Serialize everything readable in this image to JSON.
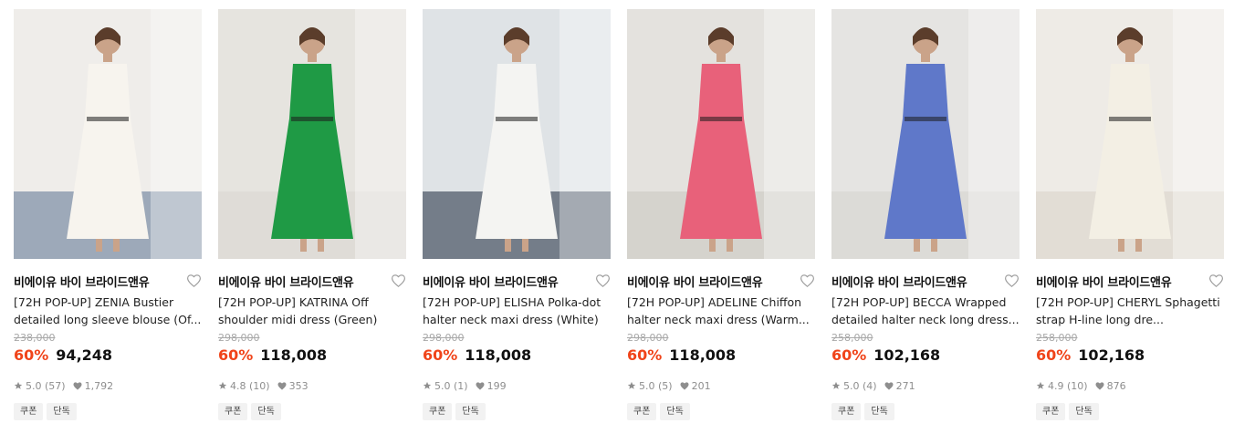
{
  "products": [
    {
      "brand": "비에이유 바이 브라이드앤유",
      "title": "[72H POP-UP] ZENIA Bustier detailed long sleeve blouse (Of...",
      "original_price": "238,000",
      "discount": "60%",
      "price": "94,248",
      "rating": "5.0 (57)",
      "likes": "1,792",
      "tags": [
        "쿠폰",
        "단독"
      ],
      "image_colors": {
        "bg": "#efedea",
        "garment": "#f7f4ee",
        "accent": "#5a7190"
      }
    },
    {
      "brand": "비에이유 바이 브라이드앤유",
      "title": "[72H POP-UP] KATRINA Off shoulder midi dress (Green)",
      "original_price": "298,000",
      "discount": "60%",
      "price": "118,008",
      "rating": "4.8 (10)",
      "likes": "353",
      "tags": [
        "쿠폰",
        "단독"
      ],
      "image_colors": {
        "bg": "#e6e4df",
        "garment": "#1f9a45",
        "accent": "#d9d6cf"
      }
    },
    {
      "brand": "비에이유 바이 브라이드앤유",
      "title": "[72H POP-UP] ELISHA Polka-dot halter neck maxi dress (White)",
      "original_price": "298,000",
      "discount": "60%",
      "price": "118,008",
      "rating": "5.0 (1)",
      "likes": "199",
      "tags": [
        "쿠폰",
        "단독"
      ],
      "image_colors": {
        "bg": "#dfe3e6",
        "garment": "#f4f4f2",
        "accent": "#1c2a3c"
      }
    },
    {
      "brand": "비에이유 바이 브라이드앤유",
      "title": "[72H POP-UP] ADELINE Chiffon halter neck maxi dress (Warm...",
      "original_price": "298,000",
      "discount": "60%",
      "price": "118,008",
      "rating": "5.0 (5)",
      "likes": "201",
      "tags": [
        "쿠폰",
        "단독"
      ],
      "image_colors": {
        "bg": "#e4e2de",
        "garment": "#e8617a",
        "accent": "#c9c6c0"
      }
    },
    {
      "brand": "비에이유 바이 브라이드앤유",
      "title": "[72H POP-UP] BECCA Wrapped detailed halter neck long dress...",
      "original_price": "258,000",
      "discount": "60%",
      "price": "102,168",
      "rating": "5.0 (4)",
      "likes": "271",
      "tags": [
        "쿠폰",
        "단독"
      ],
      "image_colors": {
        "bg": "#e5e4e2",
        "garment": "#5f78c9",
        "accent": "#d6d3cd"
      }
    },
    {
      "brand": "비에이유 바이 브라이드앤유",
      "title": "[72H POP-UP] CHERYL Sphagetti strap H-line long dre...",
      "original_price": "258,000",
      "discount": "60%",
      "price": "102,168",
      "rating": "4.9 (10)",
      "likes": "876",
      "tags": [
        "쿠폰",
        "단독"
      ],
      "image_colors": {
        "bg": "#eeebe6",
        "garment": "#f3efe4",
        "accent": "#d8d2c6"
      }
    }
  ]
}
